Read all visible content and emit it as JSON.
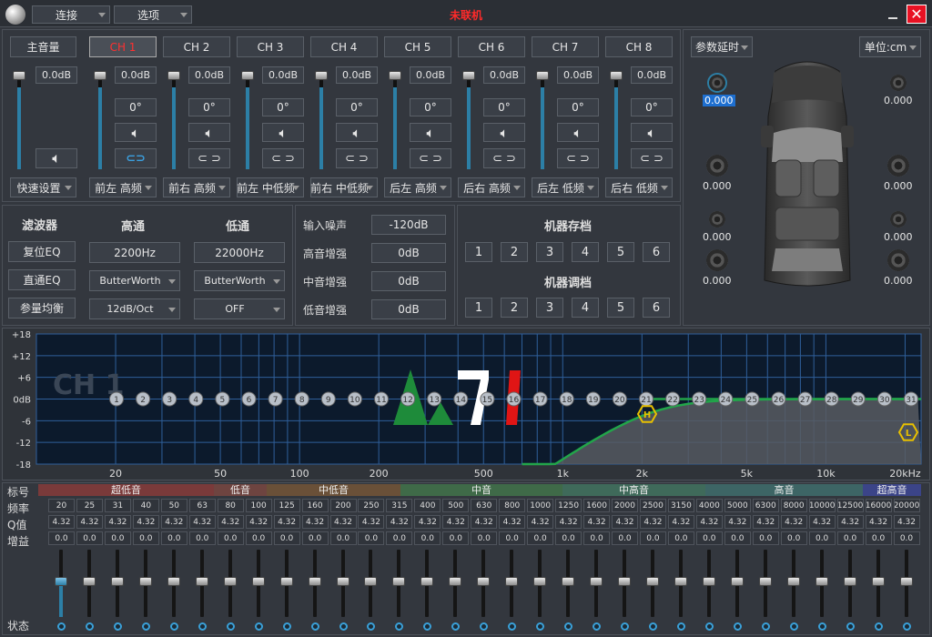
{
  "titlebar": {
    "status": "未联机",
    "menus": [
      "连接",
      "选项"
    ]
  },
  "mixer": {
    "master_label": "主音量",
    "master_value": "0.0dB",
    "channels": [
      {
        "tab": "CH 1",
        "value": "0.0dB",
        "phase": "0°",
        "type": "前左 高频",
        "selected": true
      },
      {
        "tab": "CH 2",
        "value": "0.0dB",
        "phase": "0°",
        "type": "前右 高频"
      },
      {
        "tab": "CH 3",
        "value": "0.0dB",
        "phase": "0°",
        "type": "前左 中低频"
      },
      {
        "tab": "CH 4",
        "value": "0.0dB",
        "phase": "0°",
        "type": "前右 中低频"
      },
      {
        "tab": "CH 5",
        "value": "0.0dB",
        "phase": "0°",
        "type": "后左 高频"
      },
      {
        "tab": "CH 6",
        "value": "0.0dB",
        "phase": "0°",
        "type": "后右 高频"
      },
      {
        "tab": "CH 7",
        "value": "0.0dB",
        "phase": "0°",
        "type": "后左 低频"
      },
      {
        "tab": "CH 8",
        "value": "0.0dB",
        "phase": "0°",
        "type": "后右 低频"
      }
    ],
    "quick_settings": "快速设置"
  },
  "filter": {
    "title": "滤波器",
    "high_title": "高通",
    "low_title": "低通",
    "reset_eq": "复位EQ",
    "direct_eq": "直通EQ",
    "param_eq": "参量均衡",
    "hp_freq": "2200Hz",
    "lp_freq": "22000Hz",
    "hp_type": "ButterWorth",
    "lp_type": "ButterWorth",
    "hp_slope": "12dB/Oct",
    "lp_slope": "OFF"
  },
  "noise": {
    "rows": [
      {
        "label": "输入噪声",
        "value": "-120dB"
      },
      {
        "label": "高音增强",
        "value": "0dB"
      },
      {
        "label": "中音增强",
        "value": "0dB"
      },
      {
        "label": "低音增强",
        "value": "0dB"
      }
    ]
  },
  "machine": {
    "save_title": "机器存档",
    "load_title": "机器调档",
    "slots": [
      "1",
      "2",
      "3",
      "4",
      "5",
      "6"
    ]
  },
  "delay": {
    "mode": "参数延时",
    "unit": "单位:cm",
    "values": [
      "0.000",
      "0.000",
      "0.000",
      "0.000",
      "0.000",
      "0.000",
      "0.000",
      "0.000"
    ]
  },
  "eq_graph": {
    "watermark": "CH 1",
    "y_labels": [
      "+18",
      "+12",
      "+6",
      "0dB",
      "-6",
      "-12",
      "-18"
    ],
    "x_labels": [
      "20",
      "50",
      "100",
      "200",
      "500",
      "1k",
      "2k",
      "5k",
      "10k",
      "20kHz"
    ],
    "bands": [
      "1",
      "2",
      "3",
      "4",
      "5",
      "6",
      "7",
      "8",
      "9",
      "10",
      "11",
      "12",
      "13",
      "14",
      "15",
      "16",
      "17",
      "18",
      "19",
      "20",
      "21",
      "22",
      "23",
      "24",
      "25",
      "26",
      "27",
      "28",
      "29",
      "30",
      "31"
    ],
    "hp_marker": "H",
    "lp_marker": "L"
  },
  "eq_table": {
    "row_labels": [
      "标号",
      "频率",
      "Q值",
      "增益"
    ],
    "state_label": "状态",
    "groups": [
      {
        "name": "超低音",
        "color": "#7a3a3a"
      },
      {
        "name": "低音",
        "color": "#6e4440"
      },
      {
        "name": "中低音",
        "color": "#6a5038"
      },
      {
        "name": "中音",
        "color": "#3f6a48"
      },
      {
        "name": "中高音",
        "color": "#3f6a5a"
      },
      {
        "name": "高音",
        "color": "#3d6565"
      },
      {
        "name": "超高音",
        "color": "#3b4488"
      }
    ],
    "freqs": [
      "20",
      "25",
      "31",
      "40",
      "50",
      "63",
      "80",
      "100",
      "125",
      "160",
      "200",
      "250",
      "315",
      "400",
      "500",
      "630",
      "800",
      "1000",
      "1250",
      "1600",
      "2000",
      "2500",
      "3150",
      "4000",
      "5000",
      "6300",
      "8000",
      "10000",
      "12500",
      "16000",
      "20000"
    ],
    "q": "4.32",
    "gain": "0.0"
  }
}
